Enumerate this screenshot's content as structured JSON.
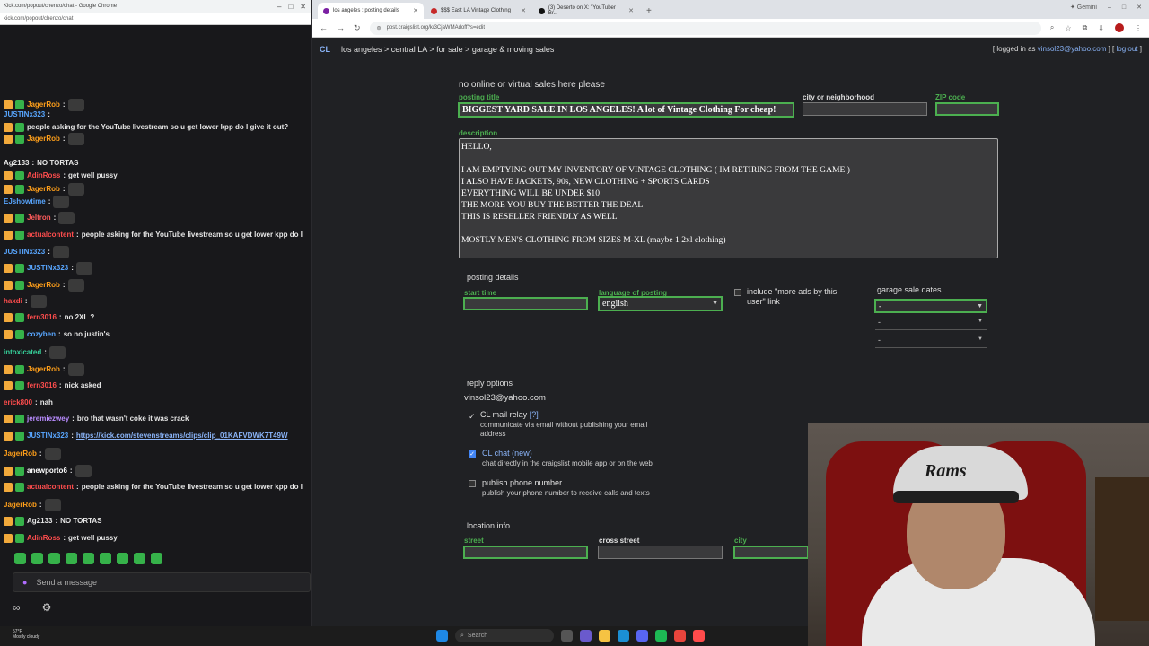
{
  "chat_window": {
    "title": "Kick.com/popout/chenzo/chat - Google Chrome",
    "url": "kick.com/popout/chenzo/chat",
    "messages": [
      {
        "user": "JagerRob",
        "color": "#ff9f1a",
        "text": "",
        "emote": true
      },
      {
        "user": "JUSTINx323",
        "color": "#58a6ff",
        "text": "",
        "emote": false
      },
      {
        "user": "",
        "color": "#ff4d4d",
        "text": "people asking for the YouTube livestream so u get lower kpp do I give it out?",
        "emote": false
      },
      {
        "user": "JagerRob",
        "color": "#ff9f1a",
        "text": "",
        "emote": true
      },
      {
        "user": "Ag2133",
        "color": "#e6e6e6",
        "text": "NO TORTAS",
        "emote": false
      },
      {
        "user": "AdinRoss",
        "color": "#ff4d4d",
        "text": "get well pussy",
        "emote": false
      },
      {
        "user": "JagerRob",
        "color": "#ff9f1a",
        "text": "",
        "emote": true
      },
      {
        "user": "EJshowtime",
        "color": "#58a6ff",
        "text": "",
        "emote": true
      },
      {
        "user": "Jeltron",
        "color": "#ff5b5b",
        "text": "",
        "emote": true
      },
      {
        "user": "actualcontent",
        "color": "#ff4d4d",
        "text": "people asking for the YouTube livestream so u get lower kpp do I",
        "emote": false
      },
      {
        "user": "JUSTINx323",
        "color": "#58a6ff",
        "text": "",
        "emote": true
      },
      {
        "user": "JUSTINx323",
        "color": "#58a6ff",
        "text": "",
        "emote": true
      },
      {
        "user": "JagerRob",
        "color": "#ff9f1a",
        "text": "",
        "emote": true
      },
      {
        "user": "haxdi",
        "color": "#ff4d4d",
        "text": "",
        "emote": true
      },
      {
        "user": "fern3016",
        "color": "#ff4d4d",
        "text": "no 2XL ?",
        "emote": false
      },
      {
        "user": "cozyben",
        "color": "#58a6ff",
        "text": "so no justin's",
        "emote": false
      },
      {
        "user": "intoxicated",
        "color": "#36d19a",
        "text": "",
        "emote": true
      },
      {
        "user": "JagerRob",
        "color": "#ff9f1a",
        "text": "",
        "emote": true
      },
      {
        "user": "fern3016",
        "color": "#ff4d4d",
        "text": "nick asked",
        "emote": false
      },
      {
        "user": "erick800",
        "color": "#ff4d4d",
        "text": "nah",
        "emote": false
      },
      {
        "user": "jeremiezwey",
        "color": "#b98cff",
        "text": "bro that wasn't coke it was crack",
        "emote": false
      },
      {
        "user": "JUSTINx323",
        "color": "#58a6ff",
        "text": "https://kick.com/stevenstreams/clips/clip_01KAFVDWK7T49W",
        "emote": false,
        "link": true
      },
      {
        "user": "JagerRob",
        "color": "#ff9f1a",
        "text": "",
        "emote": true
      },
      {
        "user": "anewporto6",
        "color": "#ffffff",
        "text": "",
        "emote": true
      },
      {
        "user": "actualcontent",
        "color": "#ff4d4d",
        "text": "people asking for the YouTube livestream so u get lower kpp do I",
        "emote": false
      },
      {
        "user": "JagerRob",
        "color": "#ff9f1a",
        "text": "",
        "emote": true
      },
      {
        "user": "Ag2133",
        "color": "#e6e6e6",
        "text": "NO TORTAS",
        "emote": false
      },
      {
        "user": "AdinRoss",
        "color": "#ff4d4d",
        "text": "get well pussy",
        "emote": false
      }
    ],
    "input_placeholder": "Send a message"
  },
  "browser": {
    "tabs": [
      {
        "title": "los angeles : posting details",
        "active": true
      },
      {
        "title": "$$$ East LA Vintage Clothing",
        "active": false
      },
      {
        "title": "(3) Deserto on X: \"YouTuber Br...",
        "active": false
      }
    ],
    "profile_label": "Gemini",
    "url": "post.craigslist.org/k/3CjaWMAdoff?s=edit"
  },
  "page": {
    "breadcrumb": "los angeles > central LA > for sale > garage & moving sales",
    "logo": "CL",
    "login_prefix": "[ logged in as",
    "login_email": "vinsol23@yahoo.com",
    "login_sep": "] [",
    "logout": "log out",
    "login_suffix": "]",
    "note": "no online or virtual sales here please",
    "posting_title_label": "posting title",
    "posting_title_value": "BIGGEST YARD SALE IN LOS ANGELES! A lot of Vintage Clothing For cheap!",
    "city_label": "city or neighborhood",
    "zip_label": "ZIP code",
    "description_label": "description",
    "description_lines": [
      "HELLO,",
      "",
      "I AM EMPTYING OUT MY INVENTORY OF VINTAGE CLOTHING ( IM RETIRING FROM THE GAME )",
      "I ALSO HAVE JACKETS, 90s, NEW CLOTHING + SPORTS CARDS",
      "EVERYTHING WILL BE UNDER $10",
      "THE MORE YOU BUY THE BETTER THE DEAL",
      "THIS IS RESELLER FRIENDLY AS WELL",
      "",
      "MOSTLY MEN'S CLOTHING FROM SIZES M-XL (maybe 1 2xl clothing)"
    ],
    "posting_details_title": "posting details",
    "start_time_label": "start time",
    "language_label": "language of posting",
    "language_value": "english",
    "include_ads_label": "include \"more ads by this user\" link",
    "garage_sale_dates_label": "garage sale dates",
    "garage_dates": [
      "-",
      "-",
      "-"
    ],
    "reply_options_title": "reply options",
    "reply_email": "vinsol23@yahoo.com",
    "cl_mail_relay": "CL mail relay",
    "cl_mail_hint": "[?]",
    "cl_mail_sub1": "communicate via email without publishing your email",
    "cl_mail_sub2": "address",
    "cl_chat": "CL chat (new)",
    "cl_chat_sub": "chat directly in the craigslist mobile app or on the web",
    "publish_phone": "publish phone number",
    "publish_phone_sub": "publish your phone number to receive calls and texts",
    "location_title": "location info",
    "street_label": "street",
    "cross_street_label": "cross street",
    "city_label2": "city"
  },
  "webcam": {
    "cap_text": "Rams"
  },
  "taskbar": {
    "weather_temp": "57°F",
    "weather_desc": "Mostly cloudy",
    "search": "Search"
  }
}
